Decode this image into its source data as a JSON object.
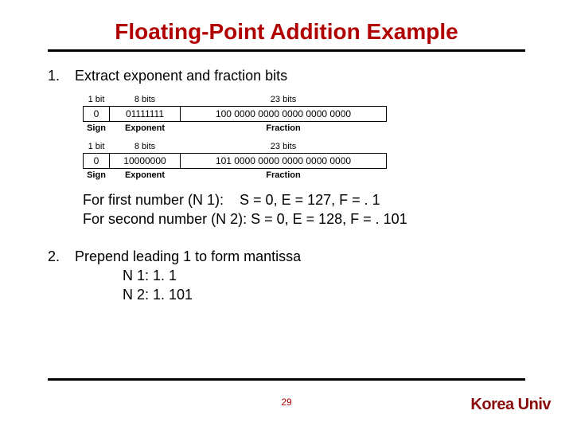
{
  "title": "Floating-Point Addition Example",
  "step1": {
    "num": "1.",
    "text": "Extract exponent and fraction bits",
    "table": {
      "head_sign": "1 bit",
      "head_exp": "8 bits",
      "head_frac": "23 bits",
      "lbl_sign": "Sign",
      "lbl_exp": "Exponent",
      "lbl_frac": "Fraction",
      "n1_sign": "0",
      "n1_exp": "01111111",
      "n1_frac": "100 0000 0000 0000 0000 0000",
      "n2_sign": "0",
      "n2_exp": "10000000",
      "n2_frac": "101 0000 0000 0000 0000 0000"
    },
    "line1": "For first number (N 1):    S = 0, E = 127, F = . 1",
    "line2": "For second number (N 2): S = 0, E = 128, F = . 101"
  },
  "step2": {
    "num": "2.",
    "text": "Prepend leading 1 to form mantissa",
    "n1": "N 1:  1. 1",
    "n2": "N 2:  1. 101"
  },
  "page": "29",
  "footer": "Korea Univ"
}
